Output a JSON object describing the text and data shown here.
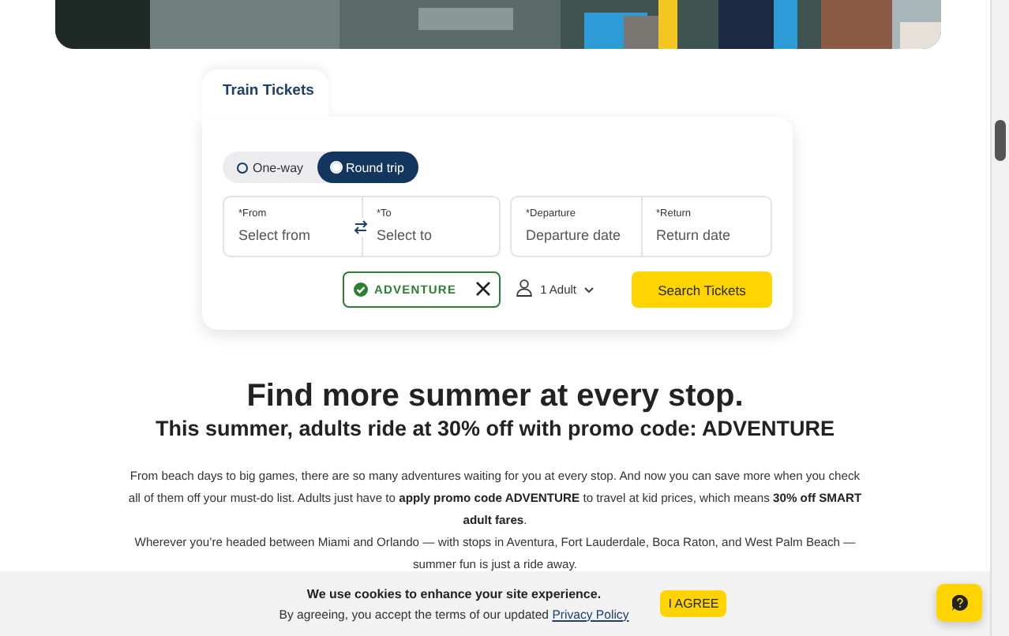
{
  "booking": {
    "tabs": [
      {
        "label": "Train Tickets",
        "selected": true
      }
    ],
    "trip_types": [
      {
        "label": "One-way",
        "selected": false
      },
      {
        "label": "Round trip",
        "selected": true
      }
    ],
    "route_fields": [
      {
        "label": "*From",
        "placeholder": "Select from"
      },
      {
        "label": "*To",
        "placeholder": "Select to"
      }
    ],
    "date_fields": [
      {
        "label": "*Departure",
        "placeholder": "Departure date"
      },
      {
        "label": "*Return",
        "placeholder": "Return date"
      }
    ],
    "promo": {
      "code": "ADVENTURE",
      "valid": true
    },
    "passengers": "1 Adult",
    "search_button": "Search Tickets"
  },
  "content": {
    "heading": "Find more summer at every stop.",
    "subheading": "This summer, adults ride at 30% off with promo code: ADVENTURE",
    "paragraphs": [
      "From beach days to big games, there are so many adventures waiting for you at every stop. And now you can save more when you check all of them off your must-do list. Adults just have to **apply promo code ADVENTURE** to travel at kid prices, which means **30% off SMART adult fares**.",
      "Wherever you’re headed between Miami and Orlando — with stops in Aventura, Fort Lauderdale, Boca Raton, and West Palm Beach — summer fun is just a ride away."
    ]
  },
  "cookie_banner": {
    "title": "We use cookies to enhance your site experience.",
    "text": "By agreeing, you accept the terms of our updated",
    "link": "Privacy Policy",
    "button": "I AGREE"
  }
}
